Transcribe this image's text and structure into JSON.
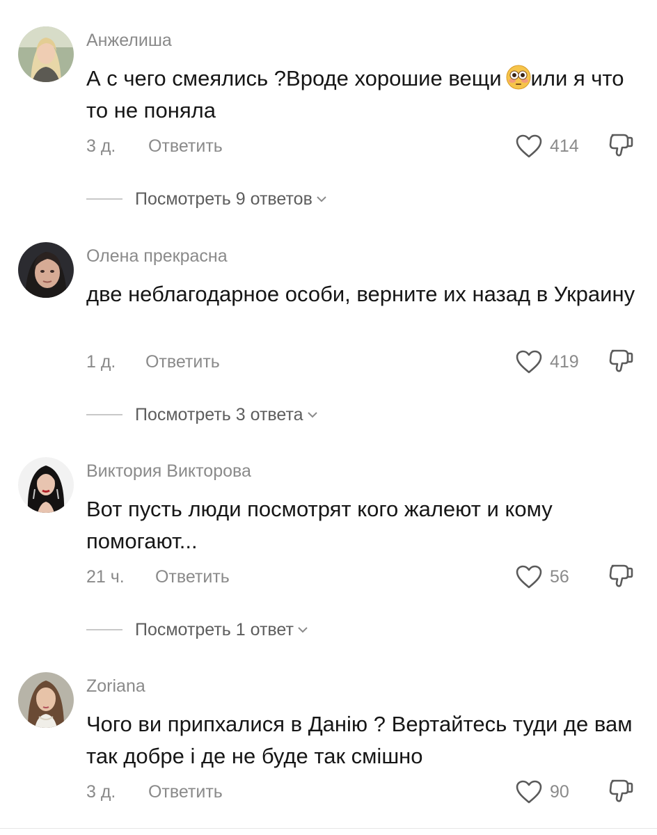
{
  "comments": [
    {
      "username": "Анжелиша",
      "text": "А с чего смеялись ?Вроде хорошие вещи",
      "emoji": "flushed-face-emoji",
      "text_after": "или я что то не поняла",
      "time": "3 д.",
      "reply_label": "Ответить",
      "likes": "414",
      "view_replies": "Посмотреть 9 ответов"
    },
    {
      "username": "Олена прекрасна",
      "text": "две неблагодарное особи, верните их назад в Украину",
      "time": "1 д.",
      "reply_label": "Ответить",
      "likes": "419",
      "view_replies": "Посмотреть 3 ответа"
    },
    {
      "username": "Виктория Викторова",
      "text": "Вот пусть люди посмотрят кого жалеют и кому помогают...",
      "time": "21 ч.",
      "reply_label": "Ответить",
      "likes": "56",
      "view_replies": "Посмотреть 1 ответ"
    },
    {
      "username": "Zoriana",
      "text": "Чого ви припхалися в Данію ? Вертайтесь туди де вам так добре і де не буде так смішно",
      "time": "3 д.",
      "reply_label": "Ответить",
      "likes": "90"
    }
  ],
  "icons": {
    "like": "heart-outline-icon",
    "dislike": "thumbs-down-outline-icon",
    "expand": "chevron-down-icon"
  },
  "colors": {
    "text": "#161616",
    "secondary": "#8a8a8a",
    "icon": "#5a5a5a"
  }
}
